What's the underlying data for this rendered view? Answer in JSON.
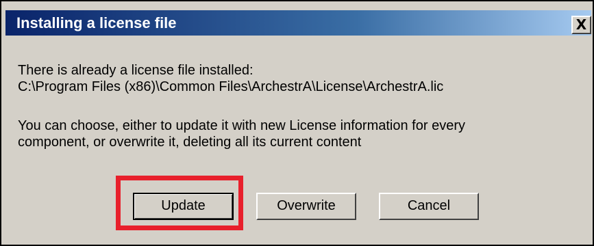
{
  "dialog": {
    "title": "Installing a license file",
    "close_symbol": "X",
    "message_line1": "There is already a license file installed:",
    "message_path": "C:\\Program Files (x86)\\Common Files\\ArchestrA\\License\\ArchestrA.lic",
    "message_line3": "You can choose, either to update it with new License information for every",
    "message_line4": "component, or overwrite it, deleting all its current content"
  },
  "buttons": {
    "update_label": "Update",
    "overwrite_label": "Overwrite",
    "cancel_label": "Cancel"
  },
  "icons": {
    "close": "close-icon"
  },
  "colors": {
    "title_gradient_start": "#0a246a",
    "title_gradient_end": "#a6caf0",
    "dialog_background": "#d4d0c8",
    "highlight": "#e8202c"
  }
}
